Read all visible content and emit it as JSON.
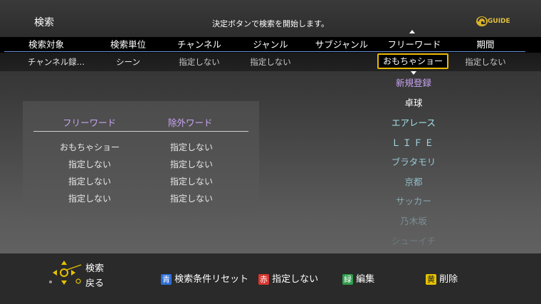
{
  "header": {
    "title": "検索",
    "hint": "決定ボタンで検索を開始します。",
    "logo_text": "GUIDE"
  },
  "columns": [
    {
      "label": "検索対象",
      "value": "チャンネル録…"
    },
    {
      "label": "検索単位",
      "value": "シーン"
    },
    {
      "label": "チャンネル",
      "value": "指定しない"
    },
    {
      "label": "ジャンル",
      "value": "指定しない"
    },
    {
      "label": "サブジャンル",
      "value": ""
    },
    {
      "label": "フリーワード",
      "value": "おもちゃショー"
    },
    {
      "label": "期間",
      "value": "指定しない"
    }
  ],
  "candidates": [
    "新規登録",
    "卓球",
    "エアレース",
    "ＬＩＦＥ",
    "ブラタモリ",
    "京都",
    "サッカー",
    "乃木坂",
    "シューイチ"
  ],
  "panel": {
    "headers": [
      "フリーワード",
      "除外ワード"
    ],
    "rows": [
      [
        "おもちゃショー",
        "指定しない"
      ],
      [
        "指定しない",
        "指定しない"
      ],
      [
        "指定しない",
        "指定しない"
      ],
      [
        "指定しない",
        "指定しない"
      ]
    ]
  },
  "footer": {
    "nav_search": "検索",
    "nav_back": "戻る",
    "blue_key": "青",
    "blue_label": "検索条件リセット",
    "red_key": "赤",
    "red_label": "指定しない",
    "green_key": "緑",
    "green_label": "編集",
    "yellow_key": "黄",
    "yellow_label": "削除"
  },
  "colors": {
    "accent_purple": "#c8a4f2",
    "selection_border": "#e9b800",
    "blue_key": "#2f6fd6",
    "red_key": "#d8372f",
    "green_key": "#2e9c4a",
    "yellow_key": "#e6c200"
  }
}
